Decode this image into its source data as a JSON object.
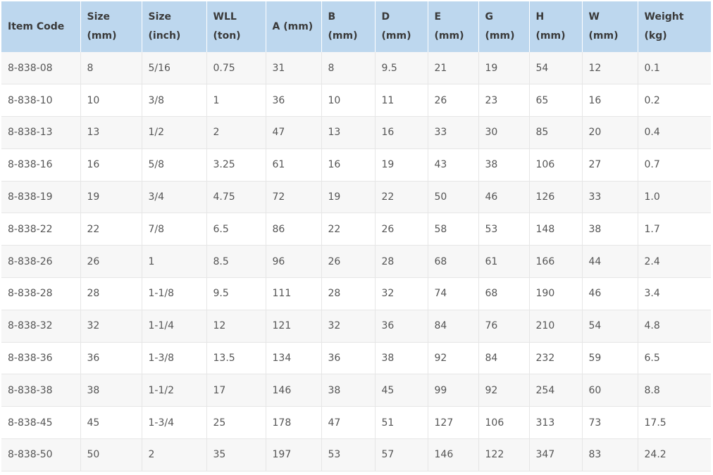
{
  "table": {
    "headers": [
      {
        "line1": "Item Code",
        "line2": ""
      },
      {
        "line1": "Size",
        "line2": "(mm)"
      },
      {
        "line1": "Size",
        "line2": "(inch)"
      },
      {
        "line1": "WLL",
        "line2": "(ton)"
      },
      {
        "line1": "A (mm)",
        "line2": ""
      },
      {
        "line1": "B (mm)",
        "line2": ""
      },
      {
        "line1": "D (mm)",
        "line2": ""
      },
      {
        "line1": "E (mm)",
        "line2": ""
      },
      {
        "line1": "G (mm)",
        "line2": ""
      },
      {
        "line1": "H (mm)",
        "line2": ""
      },
      {
        "line1": "W (mm)",
        "line2": ""
      },
      {
        "line1": "Weight (kg)",
        "line2": ""
      }
    ],
    "rows": [
      [
        "8-838-08",
        "8",
        "5/16",
        "0.75",
        "31",
        "8",
        "9.5",
        "21",
        "19",
        "54",
        "12",
        "0.1"
      ],
      [
        "8-838-10",
        "10",
        "3/8",
        "1",
        "36",
        "10",
        "11",
        "26",
        "23",
        "65",
        "16",
        "0.2"
      ],
      [
        "8-838-13",
        "13",
        "1/2",
        "2",
        "47",
        "13",
        "16",
        "33",
        "30",
        "85",
        "20",
        "0.4"
      ],
      [
        "8-838-16",
        "16",
        "5/8",
        "3.25",
        "61",
        "16",
        "19",
        "43",
        "38",
        "106",
        "27",
        "0.7"
      ],
      [
        "8-838-19",
        "19",
        "3/4",
        "4.75",
        "72",
        "19",
        "22",
        "50",
        "46",
        "126",
        "33",
        "1.0"
      ],
      [
        "8-838-22",
        "22",
        "7/8",
        "6.5",
        "86",
        "22",
        "26",
        "58",
        "53",
        "148",
        "38",
        "1.7"
      ],
      [
        "8-838-26",
        "26",
        "1",
        "8.5",
        "96",
        "26",
        "28",
        "68",
        "61",
        "166",
        "44",
        "2.4"
      ],
      [
        "8-838-28",
        "28",
        "1-1/8",
        "9.5",
        "111",
        "28",
        "32",
        "74",
        "68",
        "190",
        "46",
        "3.4"
      ],
      [
        "8-838-32",
        "32",
        "1-1/4",
        "12",
        "121",
        "32",
        "36",
        "84",
        "76",
        "210",
        "54",
        "4.8"
      ],
      [
        "8-838-36",
        "36",
        "1-3/8",
        "13.5",
        "134",
        "36",
        "38",
        "92",
        "84",
        "232",
        "59",
        "6.5"
      ],
      [
        "8-838-38",
        "38",
        "1-1/2",
        "17",
        "146",
        "38",
        "45",
        "99",
        "92",
        "254",
        "60",
        "8.8"
      ],
      [
        "8-838-45",
        "45",
        "1-3/4",
        "25",
        "178",
        "47",
        "51",
        "127",
        "106",
        "313",
        "73",
        "17.5"
      ],
      [
        "8-838-50",
        "50",
        "2",
        "35",
        "197",
        "53",
        "57",
        "146",
        "122",
        "347",
        "83",
        "24.2"
      ]
    ]
  },
  "colors": {
    "header_bg": "#bdd7ee",
    "row_odd_bg": "#f7f7f7",
    "row_even_bg": "#ffffff",
    "text": "#555555",
    "header_text": "#3a3a3a"
  }
}
